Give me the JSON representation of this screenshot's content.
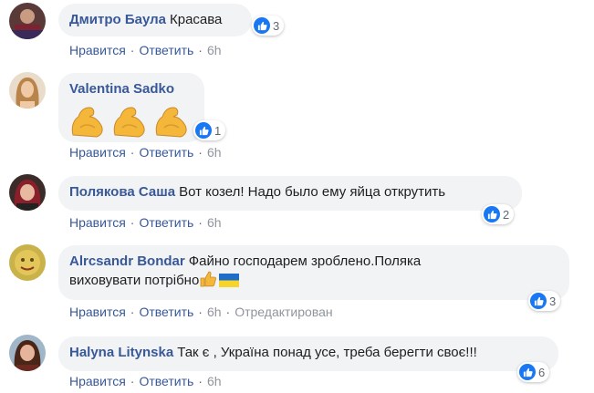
{
  "actions": {
    "like": "Нравится",
    "reply": "Ответить"
  },
  "comments": [
    {
      "author": "Дмитро Баула",
      "text": "Красава",
      "likes": "3",
      "time": "6h",
      "edited": ""
    },
    {
      "author": "Valentina Sadko",
      "text": "",
      "emoji": "flexed-biceps-emoji x3",
      "likes": "1",
      "time": "6h",
      "edited": ""
    },
    {
      "author": "Полякова Саша",
      "text": "Вот козел! Надо было ему яйца открутить",
      "likes": "2",
      "time": "6h",
      "edited": ""
    },
    {
      "author": "Alrcsandr Bondar",
      "text_line1": "Файно господарем зроблено.Поляка",
      "text_line2": "виховувати потрібно",
      "emoji": "thumbs-up-emoji, ukraine-flag-emoji",
      "likes": "3",
      "time": "6h",
      "edited": "Отредактирован"
    },
    {
      "author": "Halyna Litynska",
      "text": "Так є , Україна понад усе, треба берегти своє!!!",
      "likes": "6",
      "time": "6h",
      "edited": ""
    }
  ],
  "colors": {
    "author": "#385898",
    "bubble": "#f2f3f5",
    "like": "#1877f2",
    "meta": "#90949c"
  }
}
